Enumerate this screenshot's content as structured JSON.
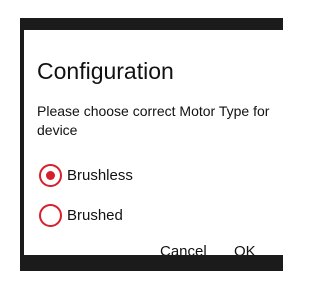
{
  "dialog": {
    "title": "Configuration",
    "message": "Please choose correct Motor Type for device",
    "options": [
      {
        "label": "Brushless",
        "selected": true
      },
      {
        "label": "Brushed",
        "selected": false
      }
    ],
    "buttons": {
      "cancel_label": "Cancel",
      "ok_label": "OK"
    }
  },
  "colors": {
    "accent": "#d51f2a",
    "frame": "#1b1b1b"
  }
}
